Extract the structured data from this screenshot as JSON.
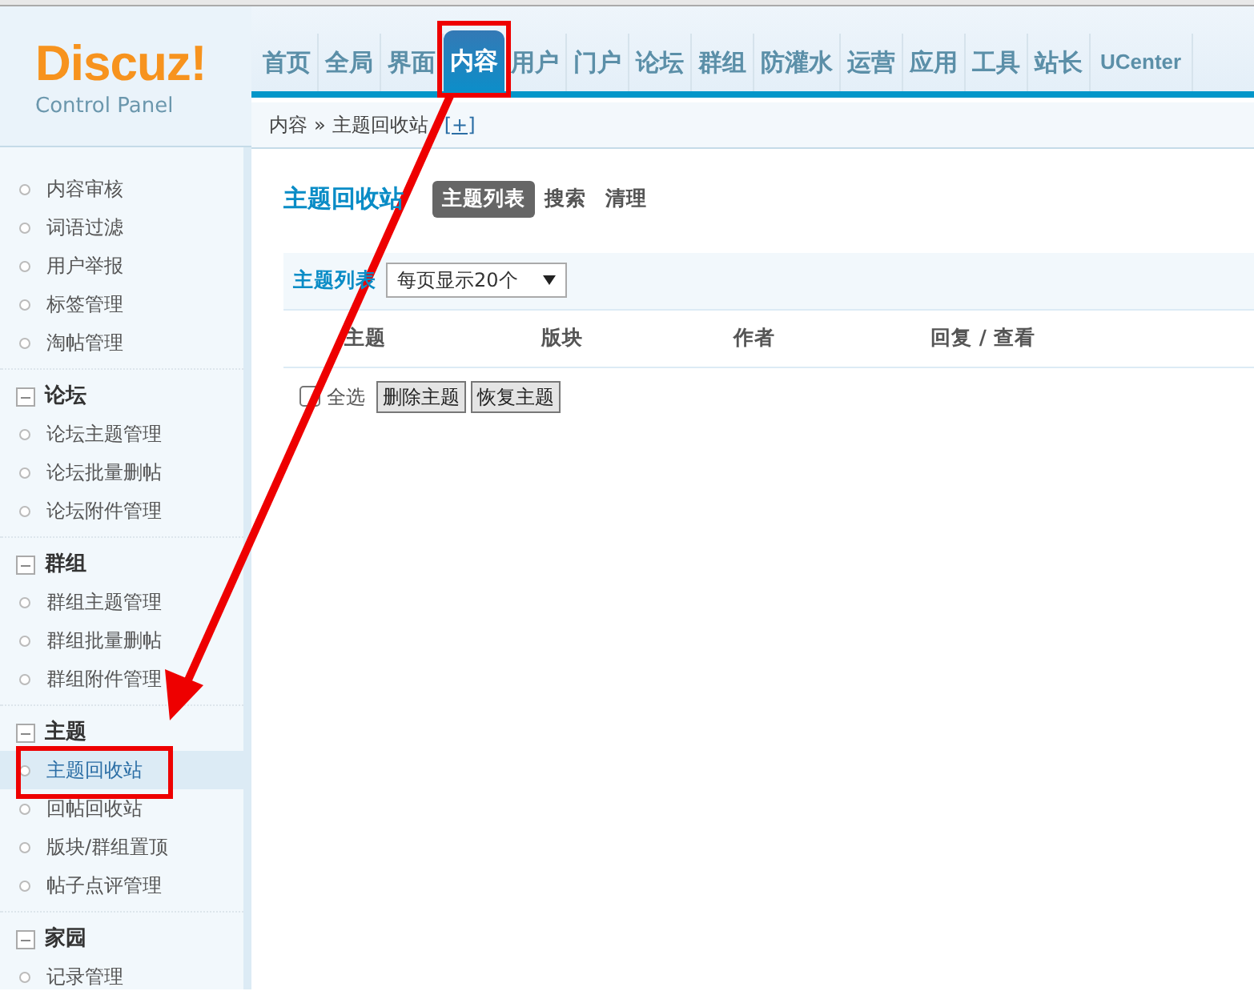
{
  "logo": {
    "title": "Discuz!",
    "subtitle": "Control Panel"
  },
  "nav": [
    {
      "label": "首页",
      "selected": false,
      "highlighted": false
    },
    {
      "label": "全局",
      "selected": false,
      "highlighted": false
    },
    {
      "label": "界面",
      "selected": false,
      "highlighted": false
    },
    {
      "label": "内容",
      "selected": true,
      "highlighted": true
    },
    {
      "label": "用户",
      "selected": false,
      "highlighted": false
    },
    {
      "label": "门户",
      "selected": false,
      "highlighted": false
    },
    {
      "label": "论坛",
      "selected": false,
      "highlighted": false
    },
    {
      "label": "群组",
      "selected": false,
      "highlighted": false
    },
    {
      "label": "防灌水",
      "selected": false,
      "highlighted": false
    },
    {
      "label": "运营",
      "selected": false,
      "highlighted": false
    },
    {
      "label": "应用",
      "selected": false,
      "highlighted": false
    },
    {
      "label": "工具",
      "selected": false,
      "highlighted": false
    },
    {
      "label": "站长",
      "selected": false,
      "highlighted": false
    },
    {
      "label": "UCenter",
      "selected": false,
      "highlighted": false
    }
  ],
  "breadcrumb": {
    "items": [
      "内容",
      "主题回收站"
    ],
    "separator": "»",
    "add": "[+]"
  },
  "sidebar": {
    "groups": [
      {
        "items": [
          {
            "label": "内容审核",
            "selected": false,
            "highlighted": false
          },
          {
            "label": "词语过滤",
            "selected": false,
            "highlighted": false
          },
          {
            "label": "用户举报",
            "selected": false,
            "highlighted": false
          },
          {
            "label": "标签管理",
            "selected": false,
            "highlighted": false
          },
          {
            "label": "淘帖管理",
            "selected": false,
            "highlighted": false
          }
        ]
      },
      {
        "title": "论坛",
        "expanded": true,
        "items": [
          {
            "label": "论坛主题管理",
            "selected": false,
            "highlighted": false
          },
          {
            "label": "论坛批量删帖",
            "selected": false,
            "highlighted": false
          },
          {
            "label": "论坛附件管理",
            "selected": false,
            "highlighted": false
          }
        ]
      },
      {
        "title": "群组",
        "expanded": true,
        "items": [
          {
            "label": "群组主题管理",
            "selected": false,
            "highlighted": false
          },
          {
            "label": "群组批量删帖",
            "selected": false,
            "highlighted": false
          },
          {
            "label": "群组附件管理",
            "selected": false,
            "highlighted": false
          }
        ]
      },
      {
        "title": "主题",
        "expanded": true,
        "items": [
          {
            "label": "主题回收站",
            "selected": true,
            "highlighted": true
          },
          {
            "label": "回帖回收站",
            "selected": false,
            "highlighted": false
          },
          {
            "label": "版块/群组置顶",
            "selected": false,
            "highlighted": false
          },
          {
            "label": "帖子点评管理",
            "selected": false,
            "highlighted": false
          }
        ]
      },
      {
        "title": "家园",
        "expanded": true,
        "items": [
          {
            "label": "记录管理",
            "selected": false,
            "highlighted": false
          }
        ]
      }
    ]
  },
  "page": {
    "title": "主题回收站",
    "tabs": [
      {
        "label": "主题列表",
        "selected": true
      },
      {
        "label": "搜索",
        "selected": false
      },
      {
        "label": "清理",
        "selected": false
      }
    ]
  },
  "toolbar": {
    "label": "主题列表",
    "per_page": "每页显示20个"
  },
  "table": {
    "columns": [
      "主题",
      "版块",
      "作者",
      "回复 / 查看"
    ]
  },
  "footer": {
    "select_all": {
      "label": "全选",
      "checked": false
    },
    "buttons": [
      "删除主题",
      "恢复主题"
    ]
  },
  "annotations": {
    "arrow": true
  }
}
